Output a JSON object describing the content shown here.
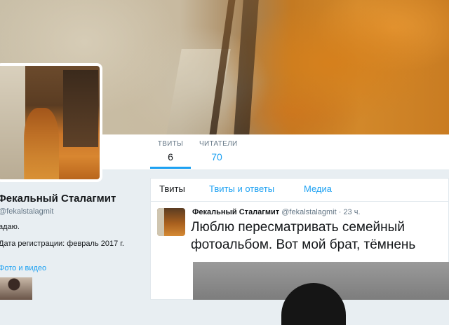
{
  "profile": {
    "name": "Фекальный Сталагмит",
    "handle": "@fekalstalagmit",
    "bio": "адаю.",
    "joined": "Дата регистрации: февраль 2017 г.",
    "media_link": "Фото и видео"
  },
  "stats": [
    {
      "label": "ТВИТЫ",
      "value": "6"
    },
    {
      "label": "ЧИТАТЕЛИ",
      "value": "70"
    }
  ],
  "timeline_tabs": [
    "Твиты",
    "Твиты и ответы",
    "Медиа"
  ],
  "tweet": {
    "name": "Фекальный Сталагмит",
    "handle": "@fekalstalagmit",
    "time": "· 23 ч.",
    "text_line1": "Люблю пересматривать семейный",
    "text_line2": "фотоальбом. Вот мой брат, тёмнень"
  },
  "colors": {
    "accent": "#1da1f2",
    "muted": "#657786",
    "text": "#14171a"
  }
}
